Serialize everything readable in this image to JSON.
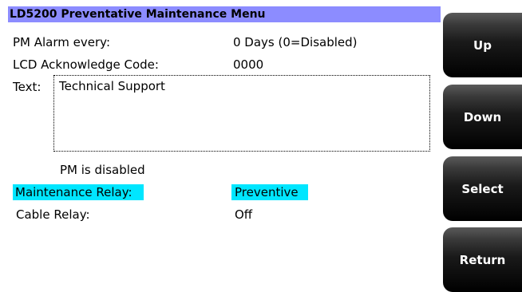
{
  "title": "LD5200 Preventative Maintenance Menu",
  "fields": {
    "pm_alarm_label": "PM Alarm every:",
    "pm_alarm_value": "0 Days (0=Disabled)",
    "lcd_ack_label": "LCD Acknowledge Code:",
    "lcd_ack_value": "0000",
    "text_label": "Text:",
    "text_value": "Technical Support",
    "pm_status": "PM is disabled",
    "maintenance_relay_label": "Maintenance Relay:",
    "maintenance_relay_value": "Preventive",
    "cable_relay_label": "Cable Relay:",
    "cable_relay_value": "Off"
  },
  "buttons": {
    "up": "Up",
    "down": "Down",
    "select": "Select",
    "return": "Return"
  },
  "colors": {
    "title_bar": "#8c8cff",
    "highlight": "#00e6ff",
    "button": "#000000"
  }
}
